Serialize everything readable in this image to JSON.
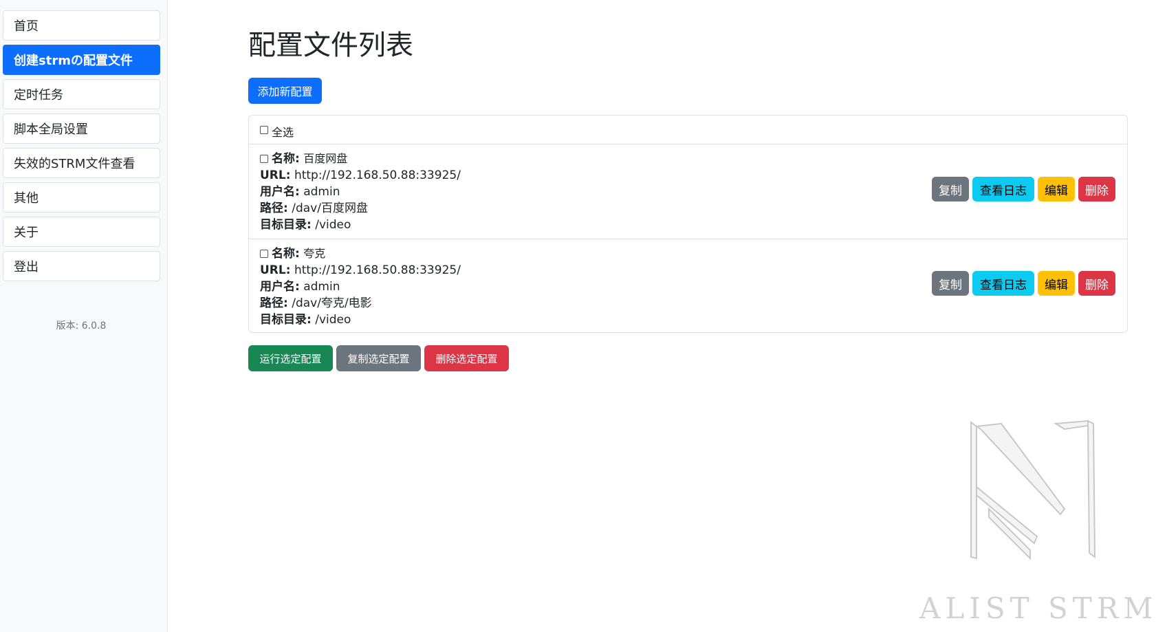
{
  "sidebar": {
    "items": [
      {
        "label": "首页",
        "active": false
      },
      {
        "label": "创建strmの配置文件",
        "active": true
      },
      {
        "label": "定时任务",
        "active": false
      },
      {
        "label": "脚本全局设置",
        "active": false
      },
      {
        "label": "失效的STRM文件查看",
        "active": false
      },
      {
        "label": "其他",
        "active": false
      },
      {
        "label": "关于",
        "active": false
      },
      {
        "label": "登出",
        "active": false
      }
    ],
    "version": "版本: 6.0.8"
  },
  "main": {
    "title": "配置文件列表",
    "add_button": "添加新配置",
    "select_all_label": "全选",
    "field_labels": {
      "name": "名称:",
      "url": "URL:",
      "username": "用户名:",
      "path": "路径:",
      "target": "目标目录:"
    },
    "configs": [
      {
        "name": "百度网盘",
        "url": "http://192.168.50.88:33925/",
        "username": "admin",
        "path": "/dav/百度网盘",
        "target": "/video"
      },
      {
        "name": "夸克",
        "url": "http://192.168.50.88:33925/",
        "username": "admin",
        "path": "/dav/夸克/电影",
        "target": "/video"
      }
    ],
    "row_actions": {
      "copy": "复制",
      "logs": "查看日志",
      "edit": "编辑",
      "delete": "删除"
    },
    "bulk_actions": {
      "run": "运行选定配置",
      "copy": "复制选定配置",
      "delete": "删除选定配置"
    }
  },
  "watermark": {
    "text": "ALIST STRM"
  },
  "colors": {
    "primary": "#0d6efd",
    "secondary": "#6c757d",
    "info": "#0dcaf0",
    "warning": "#ffc107",
    "danger": "#dc3545",
    "success": "#198754"
  }
}
